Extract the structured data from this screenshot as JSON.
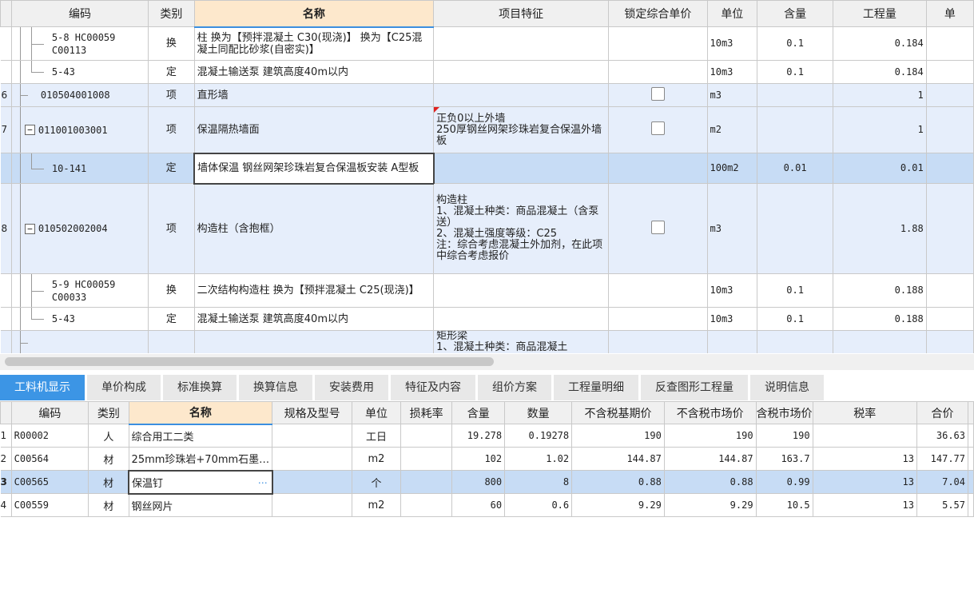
{
  "top_grid": {
    "headers": [
      "编码",
      "类别",
      "名称",
      "项目特征",
      "锁定综合单价",
      "单位",
      "含量",
      "工程量",
      "单"
    ],
    "rows": [
      {
        "rn": "",
        "code": "5-8 HC00059\nC00113",
        "type": "换",
        "name": "柱  换为【预拌混凝土 C30(现浇)】  换为【C25混凝土同配比砂浆(自密实)】",
        "feature": "",
        "lock": false,
        "unit": "10m3",
        "qty": "0.1",
        "amount": "0.184",
        "level": 2,
        "last": false,
        "style": ""
      },
      {
        "rn": "",
        "code": "5-43",
        "type": "定",
        "name": "混凝土输送泵 建筑高度40m以内",
        "feature": "",
        "lock": false,
        "unit": "10m3",
        "qty": "0.1",
        "amount": "0.184",
        "level": 2,
        "last": true,
        "style": ""
      },
      {
        "rn": "6",
        "code": "010504001008",
        "type": "项",
        "name": "直形墙",
        "feature": "",
        "lock": true,
        "unit": "m3",
        "qty": "",
        "amount": "1",
        "level": 1,
        "style": "blue"
      },
      {
        "rn": "7",
        "code": "011001003001",
        "type": "项",
        "name": "保温隔热墙面",
        "feature": "正负0以上外墙\n250厚钢丝网架珍珠岩复合保温外墙板",
        "lock": true,
        "unit": "m2",
        "qty": "",
        "amount": "1",
        "level": 1,
        "expand": true,
        "flag": true,
        "style": "blue"
      },
      {
        "rn": "",
        "code": "10-141",
        "type": "定",
        "name": "墙体保温 钢丝网架珍珠岩复合保温板安装 A型板",
        "feature": "",
        "lock": false,
        "unit": "100m2",
        "qty": "0.01",
        "amount": "0.01",
        "level": 2,
        "last": true,
        "style": "sel"
      },
      {
        "rn": "8",
        "code": "010502002004",
        "type": "项",
        "name": "构造柱（含抱框）",
        "feature": "构造柱\n1、混凝土种类：商品混凝土（含泵送）\n2、混凝土强度等级：C25\n注：综合考虑混凝土外加剂，在此项中综合考虑报价",
        "lock": true,
        "unit": "m3",
        "qty": "",
        "amount": "1.88",
        "level": 1,
        "expand": true,
        "style": "blue"
      },
      {
        "rn": "",
        "code": "5-9 HC00059\nC00033",
        "type": "换",
        "name": "二次结构构造柱  换为【预拌混凝土 C25(现浇)】",
        "feature": "",
        "lock": false,
        "unit": "10m3",
        "qty": "0.1",
        "amount": "0.188",
        "level": 2,
        "last": false,
        "style": ""
      },
      {
        "rn": "",
        "code": "5-43",
        "type": "定",
        "name": "混凝土输送泵 建筑高度40m以内",
        "feature": "",
        "lock": false,
        "unit": "10m3",
        "qty": "0.1",
        "amount": "0.188",
        "level": 2,
        "last": true,
        "style": ""
      },
      {
        "rn": "",
        "code": "",
        "type": "",
        "name": "",
        "feature": "矩形梁\n1、混凝土种类：商品混凝土",
        "lock": false,
        "unit": "",
        "qty": "",
        "amount": "",
        "level": 1,
        "style": "blue",
        "partial": true
      }
    ]
  },
  "tabs": [
    "工料机显示",
    "单价构成",
    "标准换算",
    "换算信息",
    "安装费用",
    "特征及内容",
    "组价方案",
    "工程量明细",
    "反查图形工程量",
    "说明信息"
  ],
  "active_tab": 0,
  "bottom_grid": {
    "headers": [
      "编码",
      "类别",
      "名称",
      "规格及型号",
      "单位",
      "损耗率",
      "含量",
      "数量",
      "不含税基期价",
      "不含税市场价",
      "含税市场价",
      "税率",
      "合价"
    ],
    "rows": [
      {
        "rn": "1",
        "code": "R00002",
        "type": "人",
        "name": "综合用工二类",
        "spec": "",
        "unit": "工日",
        "loss": "",
        "content": "19.278",
        "count": "0.19278",
        "base": "190",
        "market": "190",
        "taxm": "190",
        "rate": "",
        "total": "36.63"
      },
      {
        "rn": "2",
        "code": "C00564",
        "type": "材",
        "name": "25mm珍珠岩+70mm石墨…",
        "spec": "",
        "unit": "m2",
        "loss": "",
        "content": "102",
        "count": "1.02",
        "base": "144.87",
        "market": "144.87",
        "taxm": "163.7",
        "rate": "13",
        "total": "147.77"
      },
      {
        "rn": "3",
        "code": "C00565",
        "type": "材",
        "name": "保温钉",
        "spec": "",
        "unit": "个",
        "loss": "",
        "content": "800",
        "count": "8",
        "base": "0.88",
        "market": "0.88",
        "taxm": "0.99",
        "rate": "13",
        "total": "7.04",
        "sel": true
      },
      {
        "rn": "4",
        "code": "C00559",
        "type": "材",
        "name": "钢丝网片",
        "spec": "",
        "unit": "m2",
        "loss": "",
        "content": "60",
        "count": "0.6",
        "base": "9.29",
        "market": "9.29",
        "taxm": "10.5",
        "rate": "13",
        "total": "5.57"
      }
    ]
  },
  "icons": {
    "ellipsis": "…",
    "expand": "−"
  }
}
